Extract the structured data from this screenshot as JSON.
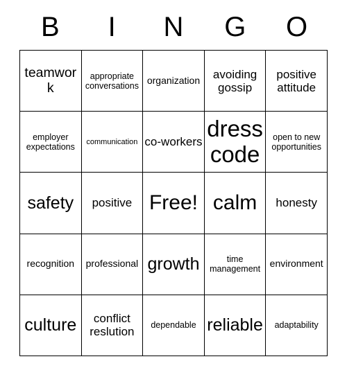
{
  "card": {
    "type": "bingo-card",
    "columns": 5,
    "rows": 5,
    "background_color": "#ffffff",
    "text_color": "#000000",
    "border_color": "#000000",
    "header": {
      "letters": [
        "B",
        "I",
        "N",
        "G",
        "O"
      ]
    },
    "free_space": {
      "label": "Free!",
      "row": 3,
      "column": 3
    },
    "rows_data": [
      [
        {
          "label": "teamwork",
          "size": "fs-l"
        },
        {
          "label": "appropriate conversations",
          "size": "fs-xs"
        },
        {
          "label": "organization",
          "size": "fs-s"
        },
        {
          "label": "avoiding gossip",
          "size": "fs-m"
        },
        {
          "label": "positive attitude",
          "size": "fs-m"
        }
      ],
      [
        {
          "label": "employer expectations",
          "size": "fs-xs"
        },
        {
          "label": "communication",
          "size": "fs-xxs"
        },
        {
          "label": "co-workers",
          "size": "fs-m"
        },
        {
          "label": "dress code",
          "size": "fs-max"
        },
        {
          "label": "open to new opportunities",
          "size": "fs-xs"
        }
      ],
      [
        {
          "label": "safety",
          "size": "fs-xl"
        },
        {
          "label": "positive",
          "size": "fs-m"
        },
        {
          "label": "Free!",
          "size": "fs-xxl"
        },
        {
          "label": "calm",
          "size": "fs-xxl"
        },
        {
          "label": "honesty",
          "size": "fs-m"
        }
      ],
      [
        {
          "label": "recognition",
          "size": "fs-s"
        },
        {
          "label": "professional",
          "size": "fs-s"
        },
        {
          "label": "growth",
          "size": "fs-xl"
        },
        {
          "label": "time management",
          "size": "fs-xs"
        },
        {
          "label": "environment",
          "size": "fs-s"
        }
      ],
      [
        {
          "label": "culture",
          "size": "fs-xl"
        },
        {
          "label": "conflict reslution",
          "size": "fs-m"
        },
        {
          "label": "dependable",
          "size": "fs-xs"
        },
        {
          "label": "reliable",
          "size": "fs-xl"
        },
        {
          "label": "adaptability",
          "size": "fs-xs"
        }
      ]
    ]
  }
}
